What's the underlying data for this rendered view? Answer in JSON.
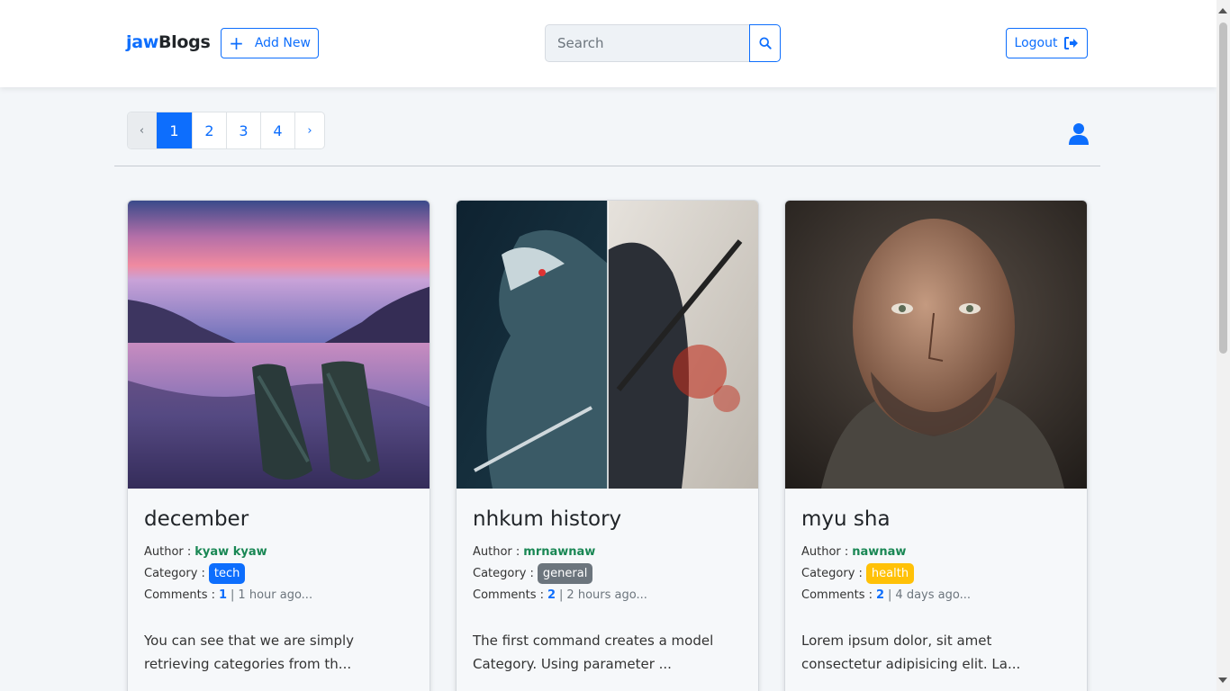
{
  "navbar": {
    "brand_part1": "jaw",
    "brand_part2": "Blogs",
    "add_new_label": "Add New",
    "search_placeholder": "Search",
    "logout_label": "Logout"
  },
  "pagination": {
    "prev": "‹",
    "pages": [
      "1",
      "2",
      "3",
      "4"
    ],
    "active_page": "1",
    "next": "›"
  },
  "labels": {
    "author": "Author :",
    "category": "Category :",
    "comments": "Comments :",
    "separator": "|"
  },
  "posts": [
    {
      "title": "december",
      "author": "kyaw kyaw",
      "category": "tech",
      "category_color": "#0d6efd",
      "comments": "1",
      "time": "1 hour ago...",
      "excerpt": "You can see that we are simply retrieving categories from th..."
    },
    {
      "title": "nhkum history",
      "author": "mrnawnaw",
      "category": "general",
      "category_color": "#6c757d",
      "comments": "2",
      "time": "2 hours ago...",
      "excerpt": "The first command creates a model Category. Using parameter ..."
    },
    {
      "title": "myu sha",
      "author": "nawnaw",
      "category": "health",
      "category_color": "#ffc107",
      "comments": "2",
      "time": "4 days ago...",
      "excerpt": "Lorem ipsum dolor, sit amet consectetur adipisicing elit. La..."
    }
  ],
  "colors": {
    "primary": "#0d6efd",
    "success": "#198754"
  }
}
